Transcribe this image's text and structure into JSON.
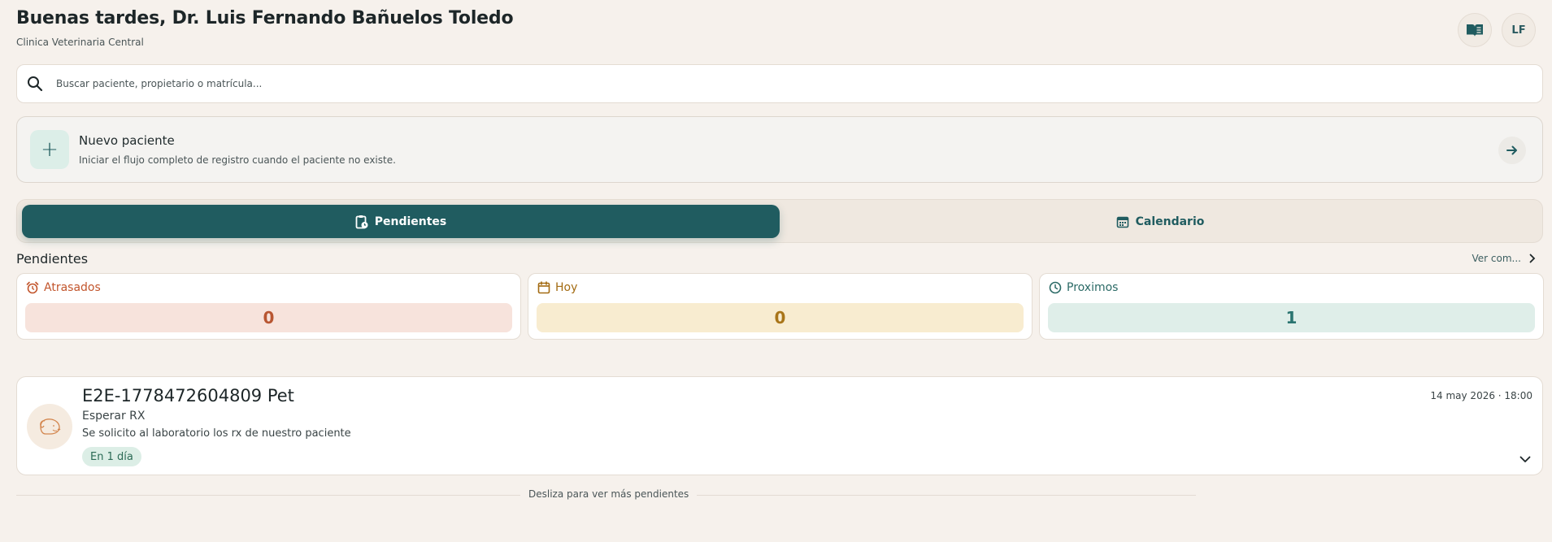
{
  "header": {
    "greeting": "Buenas tardes, Dr. Luis Fernando Bañuelos Toledo",
    "clinic": "Clinica Veterinaria Central",
    "avatar_initials": "LF",
    "book_icon": "book-open-icon"
  },
  "search": {
    "placeholder": "Buscar paciente, propietario o matrícula...",
    "value": ""
  },
  "new_patient": {
    "title": "Nuevo paciente",
    "subtitle": "Iniciar el flujo completo de registro cuando el paciente no existe."
  },
  "tabs": [
    {
      "label": "Pendientes",
      "active": true,
      "icon": "clipboard-clock-icon"
    },
    {
      "label": "Calendario",
      "active": false,
      "icon": "calendar-icon"
    }
  ],
  "pending": {
    "title": "Pendientes",
    "see_all": "Ver com...",
    "stats": [
      {
        "label": "Atrasados",
        "value": "0",
        "icon": "alarm-icon",
        "color": "#c2552c"
      },
      {
        "label": "Hoy",
        "value": "0",
        "icon": "calendar-icon",
        "color": "#a36b12"
      },
      {
        "label": "Proximos",
        "value": "1",
        "icon": "clock-icon",
        "color": "#2b6a66"
      }
    ],
    "items": [
      {
        "patient": "E2E-1778472604809 Pet",
        "task": "Esperar RX",
        "description": "Se solicito al laboratorio los rx de nuestro paciente",
        "badge": "En 1 día",
        "datetime": "14 may 2026 · 18:00"
      }
    ],
    "swipe_hint": "Desliza para ver más pendientes"
  },
  "colors": {
    "accent": "#205c60",
    "background": "#f6f1ec"
  }
}
